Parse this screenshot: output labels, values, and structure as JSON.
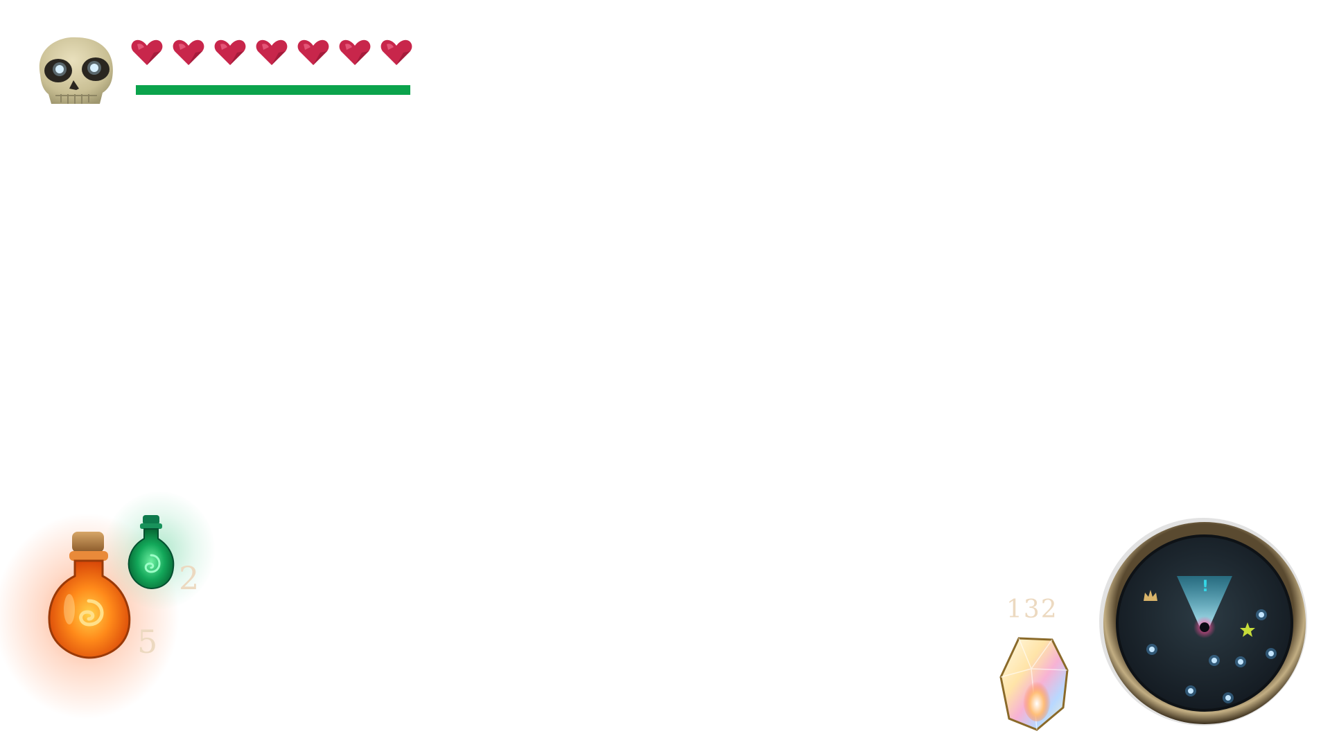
{
  "player": {
    "portrait_icon": "skull-icon",
    "hearts_count": 7,
    "heart_icon": "heart-icon",
    "heart_color": "#c8264b",
    "stamina_fraction": 1.0,
    "stamina_color": "#0ba34c"
  },
  "inventory": {
    "health_potion": {
      "icon": "orange-potion-icon",
      "count": "5"
    },
    "mana_potion": {
      "icon": "green-potion-icon",
      "count": "2"
    }
  },
  "currency": {
    "icon": "crystal-icon",
    "amount": "132"
  },
  "minimap": {
    "icon": "compass-minimap",
    "markers": [
      "crown-icon",
      "alert-icon",
      "star-icon",
      "player-icon"
    ]
  }
}
